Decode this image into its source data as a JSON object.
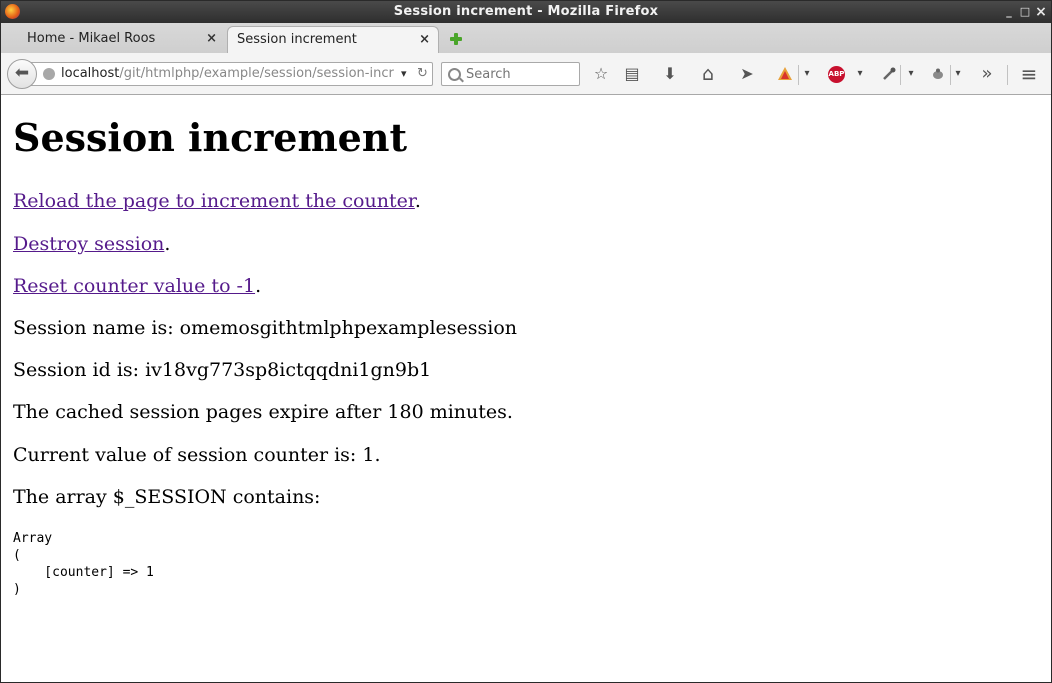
{
  "window": {
    "title": "Session increment - Mozilla Firefox",
    "minimize": "_",
    "maximize": "□",
    "close": "×"
  },
  "tabs": [
    {
      "label": "Home - Mikael Roos",
      "active": false
    },
    {
      "label": "Session increment",
      "active": true
    }
  ],
  "tab_close_glyph": "×",
  "navbar": {
    "url_host": "localhost",
    "url_path": "/git/htmlphp/example/session/session-incr",
    "search_placeholder": "Search",
    "back_glyph": "⬅",
    "reload_glyph": "↻",
    "dropdown_glyph": "▾",
    "toolbar_icons": [
      {
        "name": "bookmark-star-icon",
        "glyph": "☆"
      },
      {
        "name": "reading-list-icon",
        "glyph": "▤"
      },
      {
        "name": "downloads-icon",
        "glyph": "⬇"
      },
      {
        "name": "home-icon",
        "glyph": "⌂"
      },
      {
        "name": "send-icon",
        "glyph": "➤"
      }
    ],
    "abp_label": "ABP",
    "overflow_glyph": "»",
    "menu_glyph": "≡"
  },
  "page": {
    "heading": "Session increment",
    "links": {
      "reload": "Reload the page to increment the counter",
      "destroy": "Destroy session",
      "reset": "Reset counter value to -1"
    },
    "period": ".",
    "session_name": "Session name is: omemosgithtmlphpexamplesession",
    "session_id": "Session id is: iv18vg773sp8ictqqdni1gn9b1",
    "cache_expire": "The cached session pages expire after 180 minutes.",
    "counter_value": "Current value of session counter is: 1.",
    "array_intro": "The array $_SESSION contains:",
    "array_dump": "Array\n(\n    [counter] => 1\n)"
  }
}
